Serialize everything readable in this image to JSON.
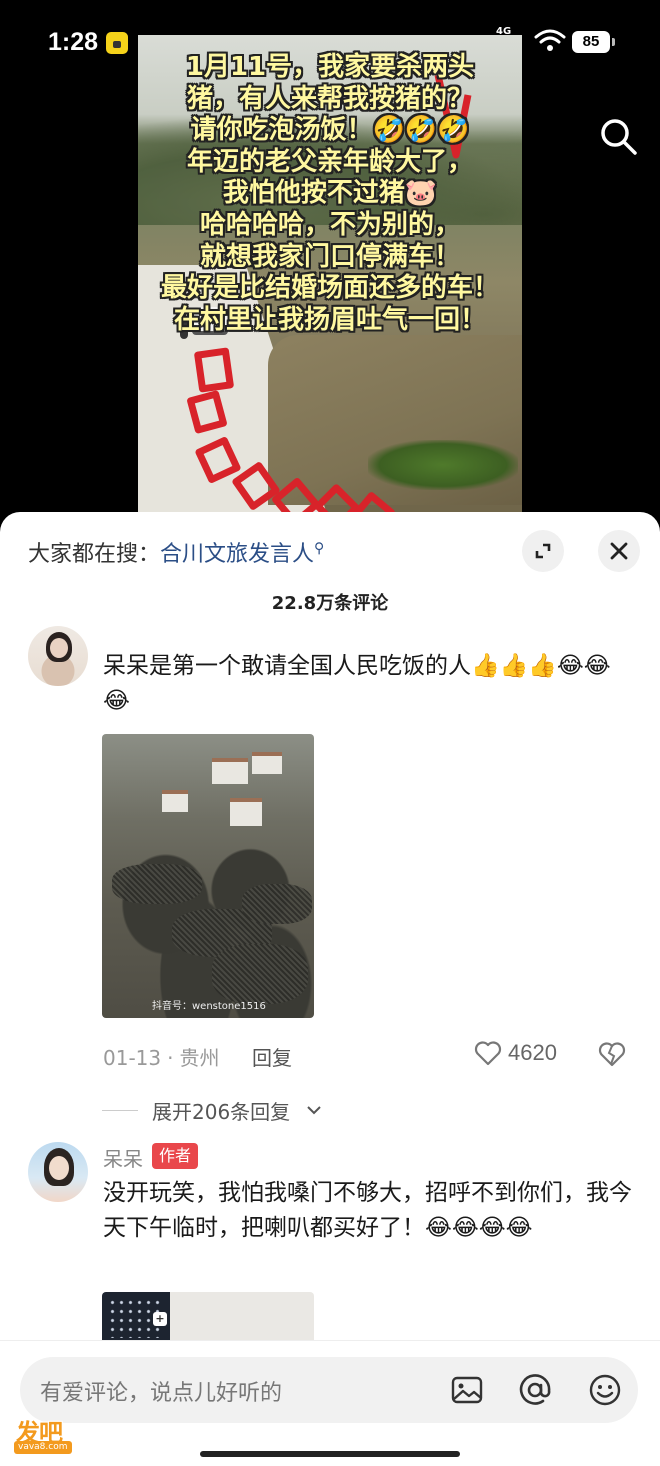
{
  "status_bar": {
    "time": "1:28",
    "network": "4G",
    "battery": "85"
  },
  "video": {
    "caption_lines": [
      "1月11号，我家要杀两头",
      "猪，有人来帮我按猪的？",
      "请你吃泡汤饭！🤣🤣🤣",
      "年迈的老父亲年龄大了，",
      "我怕他按不过猪🐷",
      "哈哈哈哈，不为别的，",
      "就想我家门口停满车！",
      "最好是比结婚场面还多的车！",
      "在村里让我扬眉吐气一回！"
    ]
  },
  "sheet": {
    "search_prefix": "大家都在搜：",
    "search_query": "合川文旅发言人",
    "comment_count": "22.8万条评论"
  },
  "comments": [
    {
      "text": "呆呆是第一个敢请全国人民吃饭的人👍👍👍😂😂😂",
      "image_watermark": "抖音号：wenstone1516",
      "date": "01-13",
      "location": "贵州",
      "reply_label": "回复",
      "likes": "4620",
      "expand_replies": "展开206条回复"
    },
    {
      "username": "呆呆",
      "author_tag": "作者",
      "text": "没开玩笑，我怕我嗓门不够大，招呼不到你们，我今天下午临时，把喇叭都买好了！😂😂😂😂"
    }
  ],
  "input_bar": {
    "placeholder": "有爱评论，说点儿好听的"
  },
  "watermark": {
    "main": "发吧",
    "sub": "vava8.com"
  },
  "colors": {
    "author_tag": "#e9474b",
    "search_query": "#2b4e86",
    "caption_text": "#fff8a0"
  }
}
